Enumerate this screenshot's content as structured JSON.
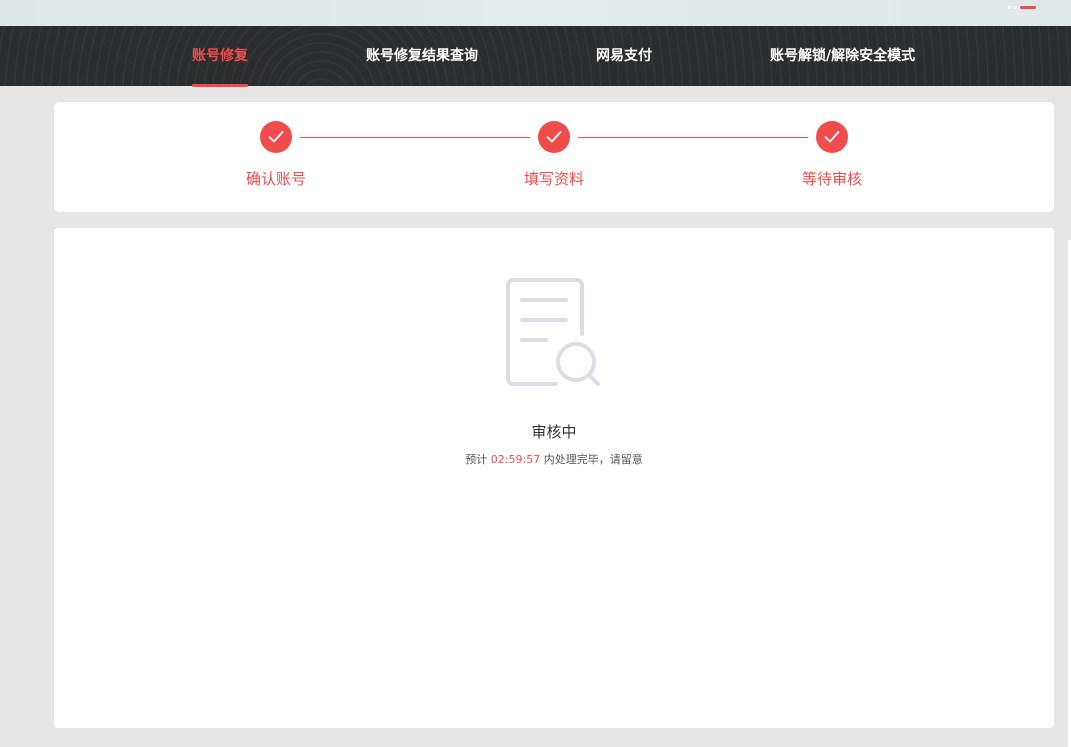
{
  "nav": {
    "tabs": [
      {
        "label": "账号修复",
        "active": true
      },
      {
        "label": "账号修复结果查询",
        "active": false
      },
      {
        "label": "网易支付",
        "active": false
      },
      {
        "label": "账号解锁/解除安全模式",
        "active": false
      }
    ]
  },
  "steps": [
    {
      "label": "确认账号",
      "icon": "check-icon",
      "status": "done"
    },
    {
      "label": "填写资料",
      "icon": "check-icon",
      "status": "done"
    },
    {
      "label": "等待审核",
      "icon": "check-icon",
      "status": "done"
    }
  ],
  "status": {
    "icon": "document-search-icon",
    "title": "审核中",
    "desc_prefix": "预计",
    "countdown": "02:59:57",
    "desc_suffix": "内处理完毕，请留意"
  },
  "colors": {
    "accent": "#f04c4c",
    "nav_bg": "#2b2d2f",
    "page_bg": "#e6e6e6",
    "icon_gray": "#dcdde2"
  }
}
